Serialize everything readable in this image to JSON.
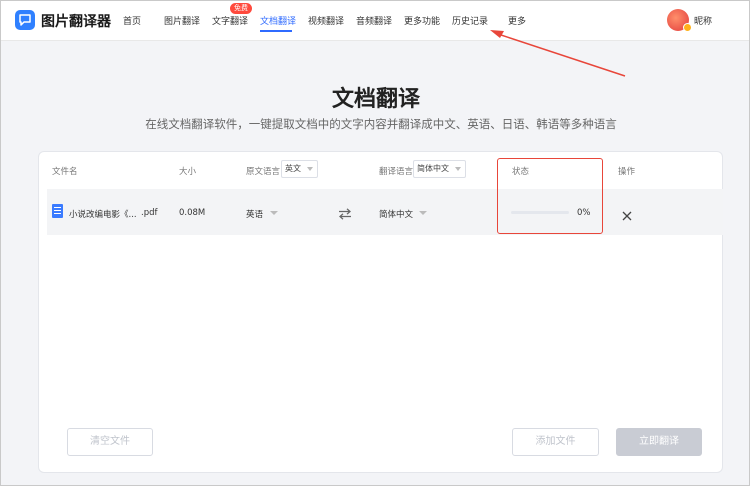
{
  "header": {
    "app_name": "图片翻译器",
    "nav": [
      {
        "label": "首页"
      },
      {
        "label": "图片翻译"
      },
      {
        "label": "文字翻译"
      },
      {
        "label": "文档翻译"
      },
      {
        "label": "视频翻译"
      },
      {
        "label": "音频翻译"
      },
      {
        "label": "更多功能"
      },
      {
        "label": "历史记录"
      },
      {
        "label": "更多"
      }
    ],
    "active_nav": "文档翻译",
    "free_badge": "免费",
    "nickname": "昵称"
  },
  "page": {
    "title": "文档翻译",
    "subtitle": "在线文档翻译软件，一键提取文档中的文字内容并翻译成中文、英语、日语、韩语等多种语言"
  },
  "table": {
    "headers": {
      "filename": "文件名",
      "size": "大小",
      "source_lang": "原文语言",
      "target_lang": "翻译语言",
      "status": "状态",
      "action": "操作"
    },
    "header_selects": {
      "source": "英文",
      "target": "简体中文"
    },
    "rows": [
      {
        "filename": "小说改编电影《...",
        "ext": ".pdf",
        "size": "0.08M",
        "source_lang": "英语",
        "target_lang": "简体中文",
        "progress_text": "0%",
        "progress": 0
      }
    ]
  },
  "buttons": {
    "clear": "清空文件",
    "add": "添加文件",
    "translate": "立即翻译"
  },
  "colors": {
    "accent": "#2f6bff",
    "annotation": "#e8463a",
    "badge": "#ff4a3d"
  }
}
